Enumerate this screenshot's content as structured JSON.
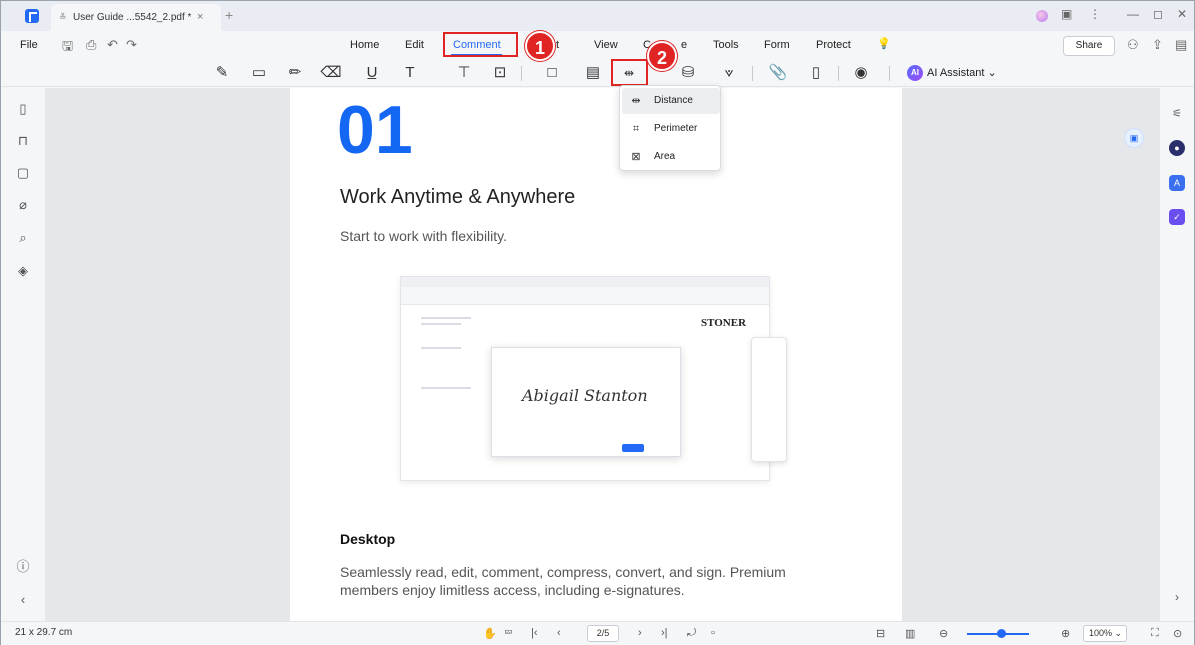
{
  "titlebar": {
    "tab_title": "User Guide ...5542_2.pdf *",
    "tab_close": "×",
    "new_tab": "+",
    "controls": [
      "⋮",
      "—",
      "◻",
      "✕"
    ]
  },
  "menubar": {
    "file": "File",
    "items": [
      "Home",
      "Edit",
      "Comment",
      "Convert",
      "View",
      "Organize",
      "Tools",
      "Form",
      "Protect"
    ],
    "visible_items": {
      "home": "Home",
      "edit": "Edit",
      "comment": "Comment",
      "convert_tail": "t",
      "view": "View",
      "organize_start": "C",
      "organize_end": "e",
      "tools": "Tools",
      "form": "Form",
      "protect": "Protect"
    },
    "share": "Share"
  },
  "toolbar": {
    "ai_assistant": "AI Assistant",
    "ai_badge": "AI"
  },
  "annotations": {
    "step1": "1",
    "step2": "2",
    "highlight_color": "#e02424"
  },
  "measure_menu": {
    "items": [
      {
        "label": "Distance",
        "icon": "distance-icon"
      },
      {
        "label": "Perimeter",
        "icon": "perimeter-icon"
      },
      {
        "label": "Area",
        "icon": "area-icon"
      }
    ]
  },
  "document": {
    "number": "01",
    "heading": "Work Anytime & Anywhere",
    "subheading": "Start to work with flexibility.",
    "section_title": "Desktop",
    "section_text": "Seamlessly read, edit, comment, compress, convert, and sign. Premium members enjoy limitless access, including e-signatures.",
    "embedded_shot": {
      "company": "STONER",
      "signature": "Abigail Stanton"
    }
  },
  "statusbar": {
    "page_size": "21 x 29.7 cm",
    "page_indicator": "2/5",
    "zoom": "100%"
  },
  "colors": {
    "accent": "#2469f5",
    "big_number": "#1467f2"
  }
}
